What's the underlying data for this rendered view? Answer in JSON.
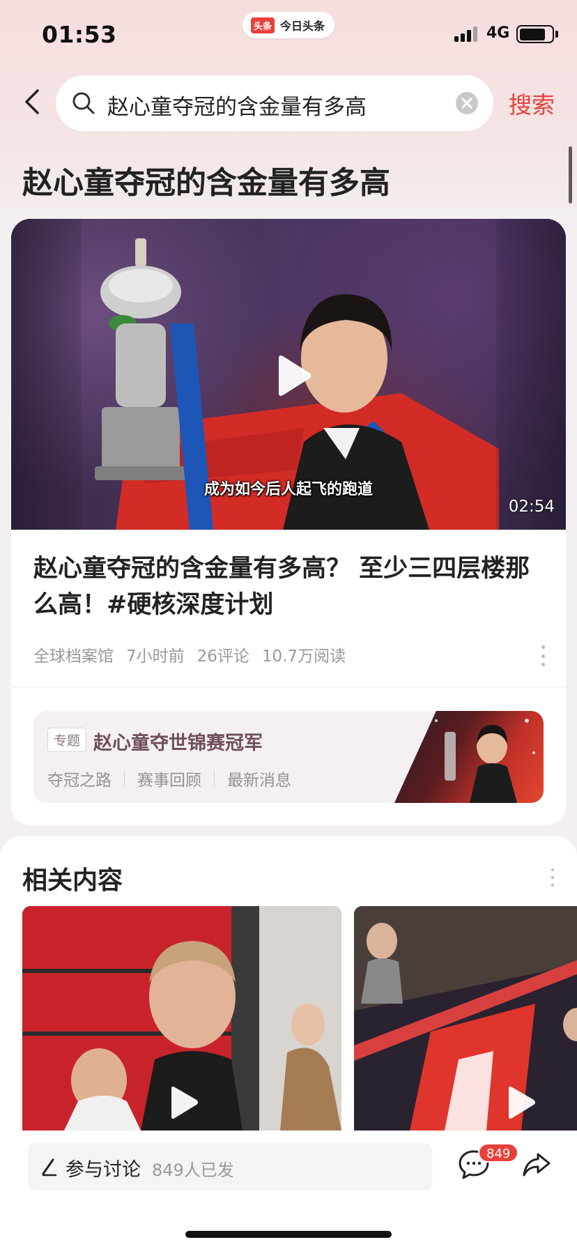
{
  "status_bar": {
    "time": "01:53",
    "app_logo_text": "头条",
    "app_name": "今日头条",
    "network": "4G",
    "battery_level": 0.8
  },
  "search": {
    "query": "赵心童夺冠的含金量有多高",
    "submit_label": "搜索"
  },
  "page": {
    "heading": "赵心童夺冠的含金量有多高"
  },
  "article": {
    "video_subtitle": "成为如今后人起飞的跑道",
    "duration": "02:54",
    "title": "赵心童夺冠的含金量有多高？ 至少三四层楼那么高！#硬核深度计划",
    "source": "全球档案馆",
    "time_ago": "7小时前",
    "comments": "26评论",
    "reads": "10.7万阅读"
  },
  "topic": {
    "tag": "专题",
    "title": "赵心童夺世锦赛冠军",
    "links": [
      "夺冠之路",
      "赛事回顾",
      "最新消息"
    ]
  },
  "related": {
    "heading": "相关内容"
  },
  "bottom_bar": {
    "discuss_label": "参与讨论",
    "discuss_count": "849人已发",
    "comment_badge": "849"
  },
  "colors": {
    "accent": "#e8413c",
    "top_tint": "#f6dede"
  }
}
